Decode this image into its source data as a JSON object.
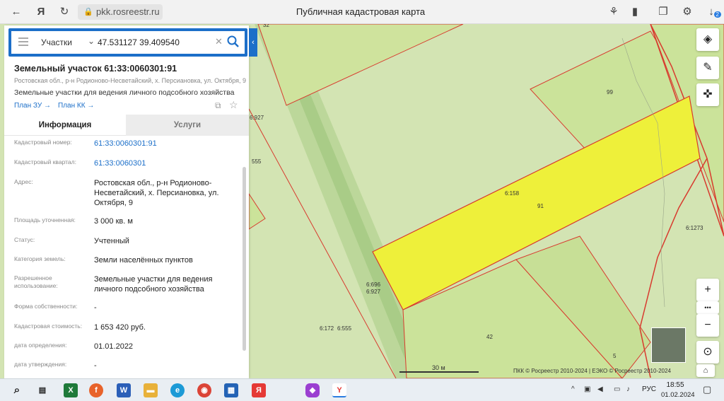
{
  "browser": {
    "back": "←",
    "yandex_logo": "Я",
    "url": "pkk.rosreestr.ru",
    "page_title": "Публичная кадастровая карта",
    "download_badge": "2"
  },
  "search": {
    "type": "Участки",
    "value": "47.531127 39.409540"
  },
  "parcel": {
    "title": "Земельный участок 61:33:0060301:91",
    "address": "Ростовская обл., р-н Родионово-Несветайский, х. Персиановка, ул. Октября, 9",
    "use": "Земельные участки для ведения личного подсобного хозяйства",
    "plan_zu": "План ЗУ →",
    "plan_kk": "План КК →"
  },
  "tabs": {
    "info": "Информация",
    "services": "Услуги"
  },
  "info_rows": [
    {
      "label": "Кадастровый номер:",
      "value": "61:33:0060301:91"
    },
    {
      "label": "Кадастровый квартал:",
      "value": "61:33:0060301"
    },
    {
      "label": "Адрес:",
      "value": "Ростовская обл., р-н Родионово-Несветайский, х. Персиановка, ул. Октября, 9"
    },
    {
      "label": "Площадь уточненная:",
      "value": "3 000 кв. м"
    },
    {
      "label": "Статус:",
      "value": "Учтенный"
    },
    {
      "label": "Категория земель:",
      "value": "Земли населённых пунктов"
    },
    {
      "label": "Разрешенное использование:",
      "value": "Земельные участки для ведения личного подсобного хозяйства"
    },
    {
      "label": "Форма собственности:",
      "value": "-"
    },
    {
      "label": "Кадастровая стоимость:",
      "value": "1 653 420 руб."
    },
    {
      "label": "дата определения:",
      "value": "01.01.2022"
    },
    {
      "label": "дата утверждения:",
      "value": "-"
    }
  ],
  "map": {
    "labels": {
      "l32": "32",
      "l99": "99",
      "l91": "91",
      "l42": "42",
      "l5": "5",
      "l6927a": "6:927",
      "l555a": "555",
      "l6158": "6:158",
      "l61273": "6:1273",
      "l6696": "6:696",
      "l6927b": "6:927",
      "l6172": "6:172",
      "l6555": "6:555"
    },
    "scale": "30 м",
    "copyright": "ПКК © Росреестр 2010-2024 | ЕЭКО © Росреестр 2010-2024",
    "zoom_in": "+",
    "zoom_out": "−",
    "more": "•••",
    "colors": {
      "selected_parcel": "#eef03a",
      "parcel": "#cbe39a",
      "border": "#d83a2e"
    }
  },
  "taskbar": {
    "lang": "РУС",
    "time": "18:55",
    "date": "01.02.2024"
  }
}
